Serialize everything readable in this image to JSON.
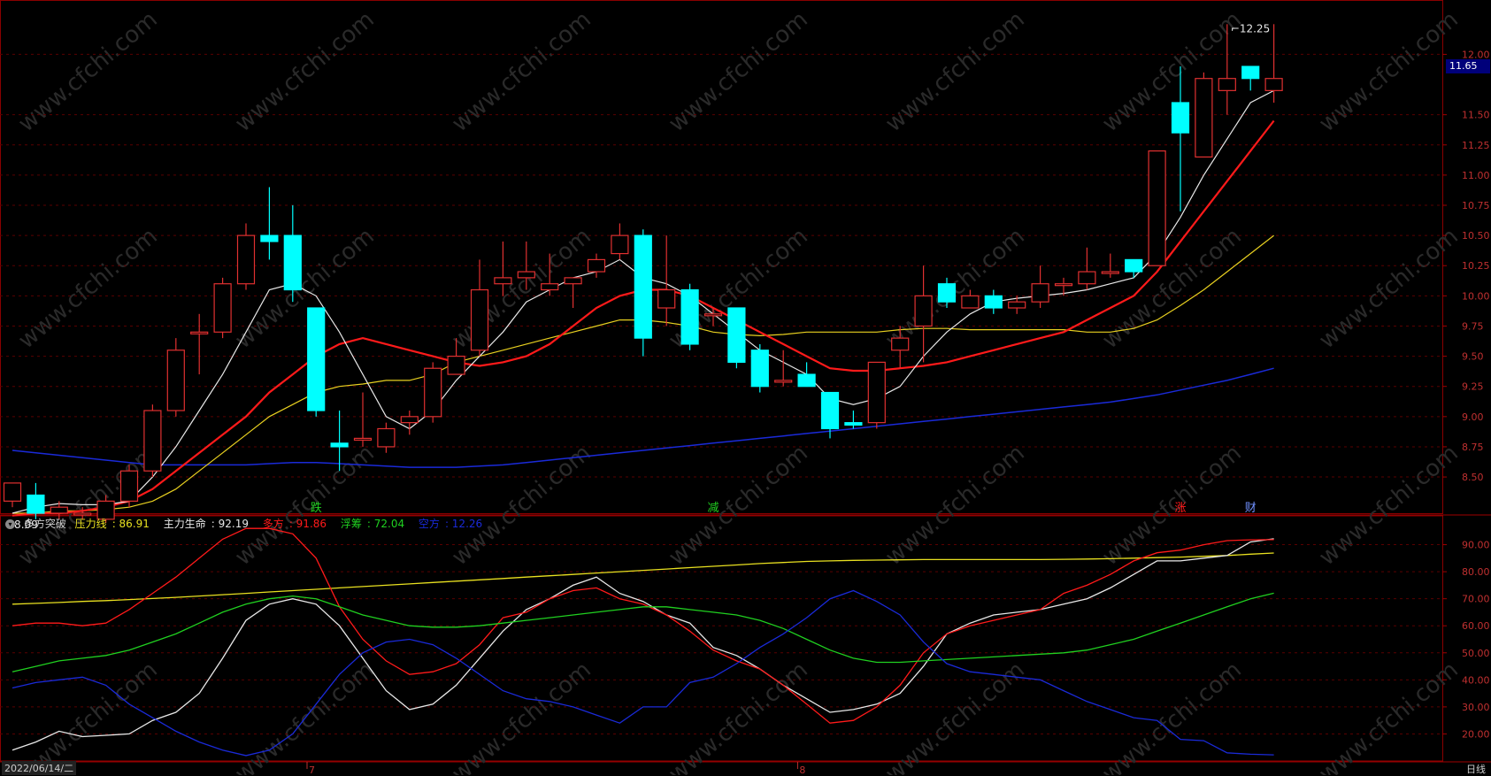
{
  "colors": {
    "up": "#e03030",
    "down": "#00ffff",
    "grid": "#5a0000",
    "ma5": "#e8e8e8",
    "ma10": "#e8d020",
    "ma20": "#ff1a1a",
    "ma60": "#1a2ad8",
    "ind_yellow": "#e8e020",
    "ind_white": "#e8e8e8",
    "ind_red": "#ff1a1a",
    "ind_green": "#20d020",
    "ind_blue": "#1a2ad8"
  },
  "chart_data": [
    {
      "type": "candlestick",
      "title": "",
      "ylim": [
        8.2,
        12.45
      ],
      "yticks": [
        8.5,
        8.75,
        9.0,
        9.25,
        9.5,
        9.75,
        10.0,
        10.25,
        10.5,
        10.75,
        11.0,
        11.25,
        11.5,
        12.0
      ],
      "current_price": "11.65",
      "high_marker": "12.25",
      "low_marker": "8.09",
      "candles": [
        [
          8.3,
          8.45,
          8.25,
          8.3
        ],
        [
          8.35,
          8.2,
          8.15,
          8.45
        ],
        [
          8.2,
          8.25,
          8.15,
          8.3
        ],
        [
          8.2,
          8.2,
          8.15,
          8.25
        ],
        [
          8.15,
          8.3,
          8.12,
          8.35
        ],
        [
          8.3,
          8.55,
          8.25,
          8.6
        ],
        [
          8.55,
          9.05,
          8.5,
          9.1
        ],
        [
          9.05,
          9.55,
          9.0,
          9.65
        ],
        [
          9.7,
          9.7,
          9.35,
          9.85
        ],
        [
          9.7,
          10.1,
          9.65,
          10.15
        ],
        [
          10.1,
          10.5,
          10.05,
          10.6
        ],
        [
          10.5,
          10.45,
          10.3,
          10.9
        ],
        [
          10.5,
          10.05,
          9.95,
          10.75
        ],
        [
          9.9,
          9.05,
          9.0,
          9.9
        ],
        [
          8.78,
          8.75,
          8.55,
          9.05
        ],
        [
          8.82,
          8.82,
          8.75,
          9.2
        ],
        [
          8.75,
          8.9,
          8.7,
          8.95
        ],
        [
          8.95,
          9.0,
          8.85,
          9.05
        ],
        [
          9.0,
          9.4,
          8.95,
          9.45
        ],
        [
          9.35,
          9.5,
          9.35,
          9.65
        ],
        [
          9.55,
          10.05,
          9.5,
          10.3
        ],
        [
          10.1,
          10.15,
          10.0,
          10.45
        ],
        [
          10.15,
          10.2,
          10.05,
          10.45
        ],
        [
          10.05,
          10.1,
          10.0,
          10.35
        ],
        [
          10.1,
          10.15,
          9.9,
          10.15
        ],
        [
          10.2,
          10.3,
          10.15,
          10.35
        ],
        [
          10.35,
          10.5,
          10.3,
          10.6
        ],
        [
          10.5,
          9.65,
          9.5,
          10.55
        ],
        [
          9.9,
          10.05,
          9.75,
          10.5
        ],
        [
          10.05,
          9.6,
          9.55,
          10.1
        ],
        [
          9.85,
          9.85,
          9.75,
          9.9
        ],
        [
          9.9,
          9.45,
          9.4,
          9.9
        ],
        [
          9.55,
          9.25,
          9.2,
          9.6
        ],
        [
          9.3,
          9.3,
          9.25,
          9.55
        ],
        [
          9.35,
          9.25,
          9.25,
          9.45
        ],
        [
          9.2,
          8.9,
          8.82,
          9.2
        ],
        [
          8.95,
          8.93,
          8.9,
          9.05
        ],
        [
          8.95,
          9.45,
          8.9,
          9.45
        ],
        [
          9.55,
          9.65,
          9.4,
          9.75
        ],
        [
          9.75,
          10.0,
          9.45,
          10.25
        ],
        [
          10.1,
          9.95,
          9.9,
          10.15
        ],
        [
          9.9,
          10.0,
          9.9,
          10.05
        ],
        [
          10.0,
          9.9,
          9.85,
          10.05
        ],
        [
          9.9,
          9.95,
          9.85,
          10.0
        ],
        [
          9.95,
          10.1,
          9.9,
          10.25
        ],
        [
          10.1,
          10.1,
          10.0,
          10.15
        ],
        [
          10.1,
          10.2,
          10.05,
          10.4
        ],
        [
          10.2,
          10.2,
          10.15,
          10.35
        ],
        [
          10.3,
          10.2,
          10.15,
          10.3
        ],
        [
          10.25,
          11.2,
          10.25,
          11.2
        ],
        [
          11.6,
          11.35,
          10.7,
          11.9
        ],
        [
          11.15,
          11.8,
          11.15,
          11.85
        ],
        [
          11.7,
          11.8,
          11.5,
          12.25
        ],
        [
          11.9,
          11.8,
          11.7,
          11.9
        ],
        [
          11.7,
          11.8,
          11.6,
          12.25
        ]
      ],
      "ma5": [
        8.2,
        8.25,
        8.28,
        8.27,
        8.27,
        8.3,
        8.5,
        8.75,
        9.05,
        9.35,
        9.7,
        10.05,
        10.1,
        10.0,
        9.7,
        9.35,
        9.0,
        8.9,
        9.05,
        9.3,
        9.5,
        9.7,
        9.95,
        10.05,
        10.15,
        10.2,
        10.3,
        10.15,
        10.1,
        10.0,
        9.85,
        9.7,
        9.55,
        9.45,
        9.35,
        9.15,
        9.1,
        9.15,
        9.25,
        9.5,
        9.7,
        9.85,
        9.95,
        9.98,
        10.0,
        10.02,
        10.05,
        10.1,
        10.15,
        10.35,
        10.65,
        11.0,
        11.3,
        11.6,
        11.7
      ],
      "ma10": [
        8.2,
        8.2,
        8.22,
        8.22,
        8.23,
        8.25,
        8.3,
        8.4,
        8.55,
        8.7,
        8.85,
        9.0,
        9.1,
        9.2,
        9.25,
        9.27,
        9.3,
        9.3,
        9.35,
        9.45,
        9.5,
        9.55,
        9.6,
        9.65,
        9.7,
        9.75,
        9.8,
        9.8,
        9.78,
        9.75,
        9.7,
        9.68,
        9.67,
        9.68,
        9.7,
        9.7,
        9.7,
        9.7,
        9.72,
        9.73,
        9.73,
        9.72,
        9.72,
        9.72,
        9.72,
        9.72,
        9.7,
        9.7,
        9.73,
        9.8,
        9.92,
        10.05,
        10.2,
        10.35,
        10.5
      ],
      "ma20": [
        8.18,
        8.2,
        8.2,
        8.22,
        8.25,
        8.3,
        8.4,
        8.55,
        8.7,
        8.85,
        9.0,
        9.2,
        9.35,
        9.5,
        9.6,
        9.65,
        9.6,
        9.55,
        9.5,
        9.45,
        9.42,
        9.45,
        9.5,
        9.6,
        9.75,
        9.9,
        10.0,
        10.05,
        10.05,
        10.0,
        9.9,
        9.8,
        9.7,
        9.6,
        9.5,
        9.4,
        9.38,
        9.38,
        9.4,
        9.42,
        9.45,
        9.5,
        9.55,
        9.6,
        9.65,
        9.7,
        9.8,
        9.9,
        10.0,
        10.2,
        10.45,
        10.7,
        10.95,
        11.2,
        11.45
      ],
      "ma60": [
        8.72,
        8.7,
        8.68,
        8.66,
        8.64,
        8.62,
        8.6,
        8.6,
        8.6,
        8.6,
        8.6,
        8.61,
        8.62,
        8.62,
        8.61,
        8.6,
        8.59,
        8.58,
        8.58,
        8.58,
        8.59,
        8.6,
        8.62,
        8.64,
        8.66,
        8.68,
        8.7,
        8.72,
        8.74,
        8.76,
        8.78,
        8.8,
        8.82,
        8.84,
        8.86,
        8.88,
        8.9,
        8.92,
        8.94,
        8.96,
        8.98,
        9.0,
        9.02,
        9.04,
        9.06,
        9.08,
        9.1,
        9.12,
        9.15,
        9.18,
        9.22,
        9.26,
        9.3,
        9.35,
        9.4
      ]
    },
    {
      "type": "line",
      "title": "多方突破",
      "ylim": [
        10,
        100
      ],
      "yticks": [
        20,
        30,
        40,
        50,
        60,
        70,
        80,
        90
      ],
      "series": [
        {
          "name": "压力线",
          "value_label": "86.91",
          "color": "#e8e020",
          "values": [
            68,
            68.3,
            68.6,
            69,
            69.3,
            69.7,
            70.1,
            70.5,
            71,
            71.5,
            72,
            72.5,
            73,
            73.5,
            74,
            74.5,
            75,
            75.5,
            76,
            76.5,
            77,
            77.5,
            78,
            78.5,
            79,
            79.5,
            80,
            80.5,
            81,
            81.5,
            82,
            82.5,
            83,
            83.4,
            83.8,
            84,
            84.2,
            84.3,
            84.4,
            84.5,
            84.5,
            84.5,
            84.5,
            84.5,
            84.5,
            84.6,
            84.7,
            84.8,
            85,
            85.2,
            85.4,
            85.7,
            86,
            86.5,
            86.91
          ]
        },
        {
          "name": "主力生命",
          "value_label": "92.19",
          "color": "#e8e8e8",
          "values": [
            14,
            17,
            21,
            19,
            19.5,
            20,
            25,
            28,
            35,
            48,
            62,
            68,
            70,
            68,
            60,
            48,
            36,
            29,
            31,
            38,
            48,
            58,
            66,
            70,
            75,
            78,
            72,
            69,
            64,
            61,
            52,
            49,
            44,
            38,
            33,
            28,
            29,
            31,
            35,
            45,
            57,
            61,
            64,
            65,
            66,
            68,
            70,
            74,
            79,
            84,
            84,
            85,
            86,
            91,
            92.19
          ]
        },
        {
          "name": "多方",
          "value_label": "91.86",
          "color": "#ff1a1a",
          "values": [
            60,
            61,
            61,
            60,
            61,
            66,
            72,
            78,
            85,
            92,
            96,
            96,
            94,
            85,
            67,
            55,
            47,
            42,
            43,
            46,
            53,
            63,
            65,
            70,
            73,
            74,
            70,
            68,
            64,
            58,
            51,
            47,
            44,
            38,
            31,
            24,
            25,
            30,
            38,
            50,
            57,
            60,
            62,
            64,
            66,
            72,
            75,
            79,
            84,
            87,
            88,
            90,
            91.5,
            91.8,
            91.86
          ]
        },
        {
          "name": "浮筹",
          "value_label": "72.04",
          "color": "#20d020",
          "values": [
            43,
            45,
            47,
            48,
            49,
            51,
            54,
            57,
            61,
            65,
            68,
            70,
            71,
            70,
            67,
            64,
            62,
            60,
            59.5,
            59.5,
            60,
            61,
            62,
            63,
            64,
            65,
            66,
            67,
            67,
            66,
            65,
            64,
            62,
            59,
            55,
            51,
            48,
            46.5,
            46.5,
            47,
            47.5,
            48,
            48.5,
            49,
            49.5,
            50,
            51,
            53,
            55,
            58,
            61,
            64,
            67,
            70,
            72.04
          ]
        },
        {
          "name": "空方",
          "value_label": "12.26",
          "color": "#1a2ad8",
          "values": [
            37,
            39,
            40,
            41,
            38,
            31,
            26,
            21,
            17,
            14,
            12,
            14,
            20,
            31,
            42,
            50,
            54,
            55,
            53,
            48,
            42,
            36,
            33,
            32,
            30,
            27,
            24,
            30,
            30,
            39,
            41,
            46,
            52,
            57,
            63,
            70,
            73,
            69,
            64,
            54,
            46,
            43,
            42,
            41,
            40,
            36,
            32,
            29,
            26,
            25,
            18,
            17.5,
            13,
            12.5,
            12.26
          ]
        }
      ]
    }
  ],
  "markers": [
    {
      "text": "跌",
      "color": "#20d020",
      "index": 13
    },
    {
      "text": "减",
      "color": "#20d020",
      "index": 30
    },
    {
      "text": "涨",
      "color": "#ff1a1a",
      "index": 50
    },
    {
      "text": "财",
      "color": "#7090ff",
      "index": 53
    }
  ],
  "x_axis": {
    "date_label": "2022/06/14/二",
    "month_ticks": [
      {
        "text": "7",
        "index": 13
      },
      {
        "text": "8",
        "index": 34
      }
    ]
  },
  "period": "日线",
  "watermark": "www.cfchi.com",
  "indicator_icon": "chevron-down-icon"
}
